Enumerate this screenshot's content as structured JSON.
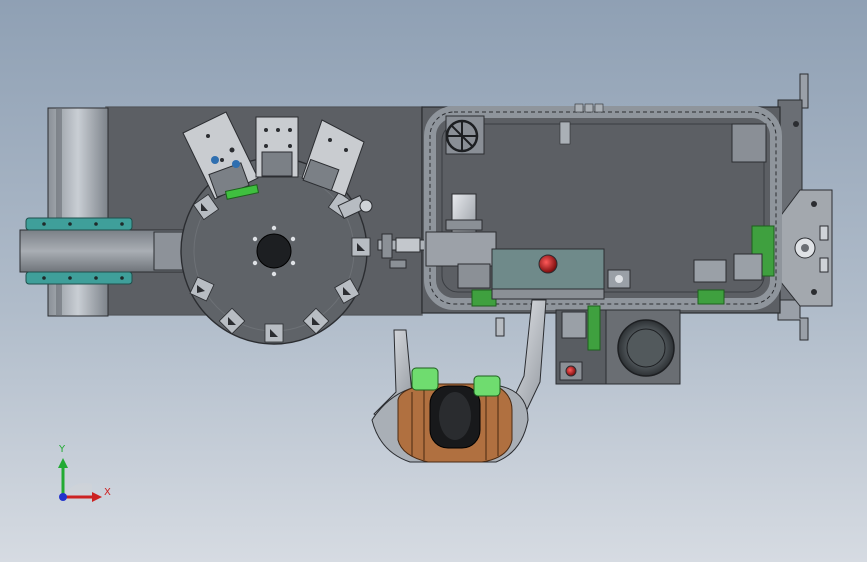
{
  "viewport": {
    "background_top": "#8fa0b4",
    "background_bottom": "#d6dbe2"
  },
  "triad": {
    "x_label": "X",
    "y_label": "Y",
    "x_color": "#cc2222",
    "y_color": "#22aa33",
    "z_color": "#2233cc"
  },
  "colors": {
    "frame": "#5a5d62",
    "frame_edge": "#2b2d31",
    "conveyor_accent": "#3f9f9a",
    "green_part": "#3fbf3f",
    "copper": "#b07040",
    "red_button": "#b01818"
  },
  "model": {
    "components": [
      {
        "name": "infeed-conveyor"
      },
      {
        "name": "rotary-index-table"
      },
      {
        "name": "chain-conveyor-loop"
      },
      {
        "name": "hand-wheel"
      },
      {
        "name": "motor-bowl-unit"
      },
      {
        "name": "transformer-coil-part"
      }
    ]
  }
}
